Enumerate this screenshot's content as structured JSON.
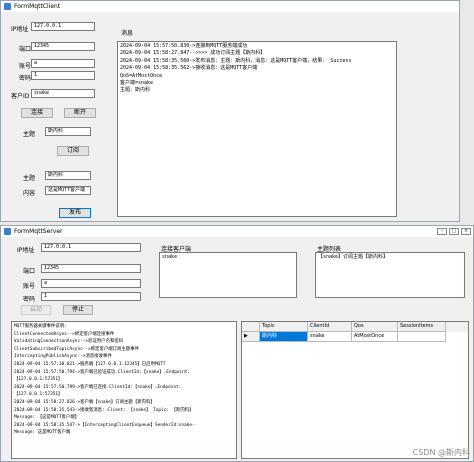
{
  "client": {
    "title": "FormMqttClient",
    "ip_label": "IP地址",
    "ip_value": "127.0.0.1",
    "port_label": "端口",
    "port_value": "12345",
    "user_label": "账号",
    "user_value": "a",
    "pwd_label": "密码",
    "pwd_value": "1",
    "clientid_label": "客户ID",
    "clientid_value": "snake",
    "connect_button": "连接",
    "disconnect_button": "断开",
    "topic_label": "主题",
    "topic_value": "斯内科",
    "subscribe_button": "订阅",
    "pub_topic_label": "主题",
    "pub_topic_value": "斯内科",
    "content_label": "内容",
    "content_value": "这是MQTT客户端",
    "send_button": "发布",
    "message_label": "消息",
    "log": [
      "2024-09-04 15:57:50.830->连接到MQTT服务端成功",
      "2024-09-04 15:58:27.847-->>>> 成功订阅主题【斯内科】",
      "2024-09-04 15:58:35.560->发布消息：主题：斯内科，消息：这是MQTT客户端，结果： Success",
      "2024-09-04 15:58:35.562->接收消息：这是MQTT客户端",
      "QoS=AtMostOnce",
      "客户端=snake",
      "主题：斯内科"
    ]
  },
  "server": {
    "title": "FormMqttServer",
    "ip_label": "IP地址",
    "ip_value": "127.0.0.1",
    "port_label": "端口",
    "port_value": "12345",
    "user_label": "账号",
    "user_value": "a",
    "pwd_label": "密码",
    "pwd_value": "1",
    "start_button": "启动",
    "stop_button": "停止",
    "clients_label": "连接客户端",
    "clients": [
      "snake"
    ],
    "topics_label": "主题列表",
    "topics": [
      "【snake】订阅主题【斯内科】"
    ],
    "log": [
      "MQTT服务器关键事件说明:",
      "ClientConnectedAsync-->绑定客户端连接事件",
      "ValidatingConnectionAsync-->验证用户名和密码",
      "ClientSubscribedTopicAsync-->绑定客户端订阅主题事件",
      "InterceptingPublishAsync-->消息接收事件",
      "2024-09-04 15:57:30.821->服务端【127.0.0.1:12345】已启用MQTT",
      "2024-09-04 15:57:50.794->客户端已验证成功.ClientId:【snake】,Endpoint:",
      "【127.0.0.1:57351】",
      "2024-09-04 15:57:50.799->客户端已连接.ClientId:【snake】,Endpoint:",
      "【127.0.0.1:57351】",
      "2024-09-04 15:58:27.826->客户端【snake】订阅主题【斯内科】",
      "2024-09-04 15:58:35.543->接收到消息: Client: 【snake】 Topic: 【斯内科】",
      "Message: 【这是MQTT客户端】",
      "2024-09-04 15:58:35.547->【InterceptingClientEnqueue】SenderId:snake-",
      "Message: 这是MQTT客户端"
    ],
    "grid": {
      "columns": [
        "Topic",
        "ClientId",
        "Qos",
        "SessionItems"
      ],
      "rows": [
        {
          "marker": "▶",
          "topic": "斯内科",
          "clientid": "snake",
          "qos": "AtMostOnce",
          "session": ""
        }
      ]
    }
  },
  "watermark": "CSDN @斯内科"
}
